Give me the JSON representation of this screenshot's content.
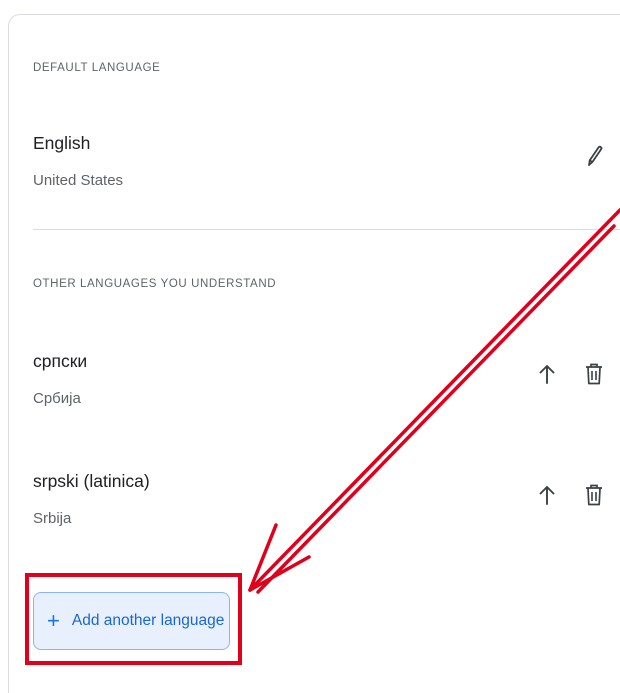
{
  "default_section": {
    "heading": "DEFAULT LANGUAGE",
    "language": {
      "name": "English",
      "region": "United States",
      "edit_icon": "pencil-icon"
    }
  },
  "other_section": {
    "heading": "OTHER LANGUAGES YOU UNDERSTAND",
    "languages": [
      {
        "name": "српски",
        "region": "Србија",
        "move_up_icon": "arrow-up-icon",
        "delete_icon": "trash-icon"
      },
      {
        "name": "srpski (latinica)",
        "region": "Srbija",
        "move_up_icon": "arrow-up-icon",
        "delete_icon": "trash-icon"
      }
    ]
  },
  "add_button": {
    "plus": "+",
    "label": "Add another language"
  },
  "colors": {
    "annotation_red": "#e0001b",
    "button_bg": "#e8f0fe",
    "button_text": "#1967d2"
  }
}
